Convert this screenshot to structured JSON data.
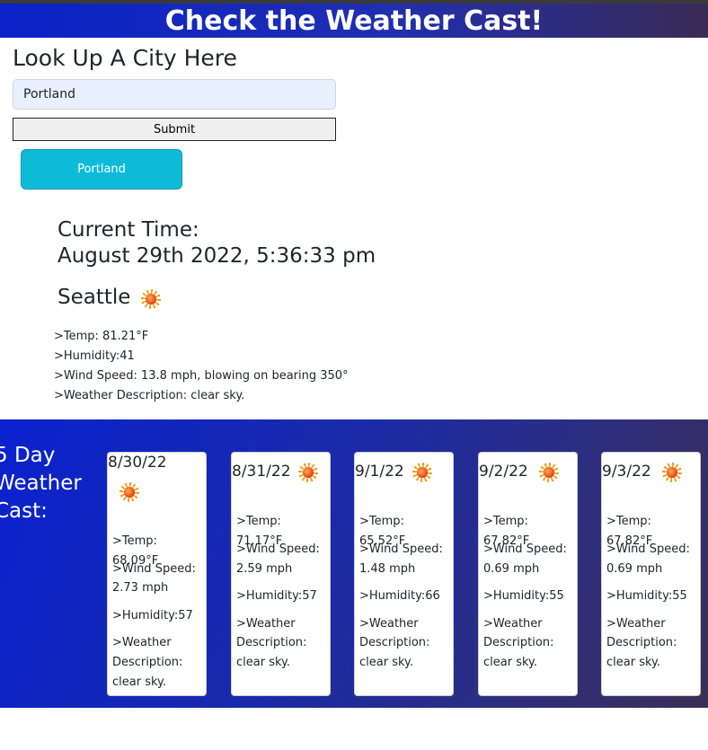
{
  "header": {
    "title": "Check the Weather Cast!"
  },
  "search": {
    "heading": "Look Up A City Here",
    "input_value": "Portland",
    "submit_label": "Submit",
    "history": [
      "Portland"
    ]
  },
  "current": {
    "time_label": "Current Time:",
    "time_value": "August 29th 2022, 5:36:33 pm",
    "city": "Seattle",
    "icon": "sun-icon",
    "temp": ">Temp: 81.21°F",
    "humidity": ">Humidity:41",
    "wind": ">Wind Speed: 13.8 mph, blowing on bearing 350°",
    "description": ">Weather Description: clear sky."
  },
  "forecast": {
    "title_lines": [
      "5 Day",
      "Weather",
      "Cast:"
    ],
    "days": [
      {
        "date": "8/30/22",
        "icon": "sun-icon",
        "temp": ">Temp: 68.09°F",
        "wind_label": ">Wind Speed:",
        "wind_value": "2.73 mph",
        "humidity": ">Humidity:57",
        "desc_label": ">Weather",
        "desc_mid": "Description:",
        "desc_value": "clear sky."
      },
      {
        "date": "8/31/22",
        "icon": "sun-icon",
        "temp": ">Temp: 71.17°F",
        "wind_label": ">Wind Speed:",
        "wind_value": "2.59 mph",
        "humidity": ">Humidity:57",
        "desc_label": ">Weather",
        "desc_mid": "Description:",
        "desc_value": "clear sky."
      },
      {
        "date": "9/1/22",
        "icon": "sun-icon",
        "temp": ">Temp: 65.52°F",
        "wind_label": ">Wind Speed:",
        "wind_value": "1.48 mph",
        "humidity": ">Humidity:66",
        "desc_label": ">Weather",
        "desc_mid": "Description:",
        "desc_value": "clear sky."
      },
      {
        "date": "9/2/22",
        "icon": "sun-icon",
        "temp": ">Temp: 67.82°F",
        "wind_label": ">Wind Speed:",
        "wind_value": "0.69 mph",
        "humidity": ">Humidity:55",
        "desc_label": ">Weather",
        "desc_mid": "Description:",
        "desc_value": "clear sky."
      },
      {
        "date": "9/3/22",
        "icon": "sun-icon",
        "temp": ">Temp: 67.82°F",
        "wind_label": ">Wind Speed:",
        "wind_value": "0.69 mph",
        "humidity": ">Humidity:55",
        "desc_label": ">Weather",
        "desc_mid": "Description:",
        "desc_value": "clear sky."
      }
    ]
  },
  "colors": {
    "header_start": "#0a22c8",
    "header_end": "#3a2a55",
    "history_button": "#0dbad8",
    "input_bg": "#e8f0fe"
  }
}
